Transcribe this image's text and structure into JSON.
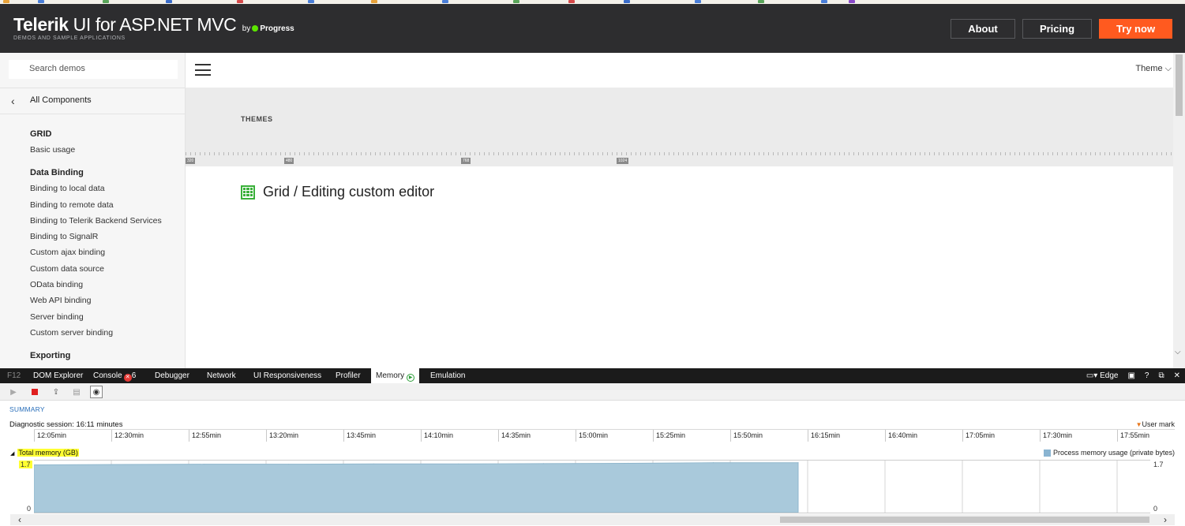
{
  "header": {
    "logo_brand": "Telerik",
    "logo_product": "UI for ASP.NET MVC",
    "logo_by": "by",
    "logo_company": "Progress",
    "logo_sub": "DEMOS AND SAMPLE APPLICATIONS",
    "about": "About",
    "pricing": "Pricing",
    "try_now": "Try now",
    "accent": "#ff5a1f"
  },
  "sidebar": {
    "search_placeholder": "Search demos",
    "back_label": "All Components",
    "sections": [
      {
        "title": "GRID",
        "items": [
          "Basic usage"
        ]
      },
      {
        "title": "Data Binding",
        "items": [
          "Binding to local data",
          "Binding to remote data",
          "Binding to Telerik Backend Services",
          "Binding to SignalR",
          "Custom ajax binding",
          "Custom data source",
          "OData binding",
          "Web API binding",
          "Server binding",
          "Custom server binding"
        ]
      },
      {
        "title": "Exporting",
        "items": []
      }
    ]
  },
  "content": {
    "theme_label": "Theme",
    "themes_heading": "THEMES",
    "ruler_marks": [
      "320",
      "480",
      "768",
      "1024"
    ],
    "page_title": "Grid / Editing custom editor"
  },
  "devtools": {
    "tabs": [
      "F12",
      "DOM Explorer",
      "Console",
      "Debugger",
      "Network",
      "UI Responsiveness",
      "Profiler",
      "Memory",
      "Emulation"
    ],
    "console_errors": "6",
    "active_tab": "Memory",
    "browser_mode": "Edge",
    "help": "?",
    "summary": "SUMMARY",
    "session": "Diagnostic session: 16:11 minutes",
    "user_mark": "User mark",
    "timeline_labels": [
      "12:05min",
      "12:30min",
      "12:55min",
      "13:20min",
      "13:45min",
      "14:10min",
      "14:35min",
      "15:00min",
      "15:25min",
      "15:50min",
      "16:15min",
      "16:40min",
      "17:05min",
      "17:30min",
      "17:55min"
    ],
    "memory_title": "Total memory (GB)",
    "legend": "Process memory usage (private bytes)",
    "y_max": "1.7",
    "y_min": "0",
    "area_color": "#a9c9db"
  },
  "chart_data": {
    "type": "area",
    "title": "Total memory (GB)",
    "series": [
      {
        "name": "Process memory usage (private bytes)",
        "x": [
          "12:05min",
          "12:30min",
          "12:55min",
          "13:20min",
          "13:45min",
          "14:10min",
          "14:35min",
          "15:00min",
          "15:25min",
          "15:50min"
        ],
        "values": [
          1.56,
          1.57,
          1.58,
          1.58,
          1.59,
          1.59,
          1.6,
          1.61,
          1.63,
          1.63
        ]
      }
    ],
    "ylim": [
      0,
      1.7
    ],
    "xlabel": "",
    "ylabel": ""
  }
}
